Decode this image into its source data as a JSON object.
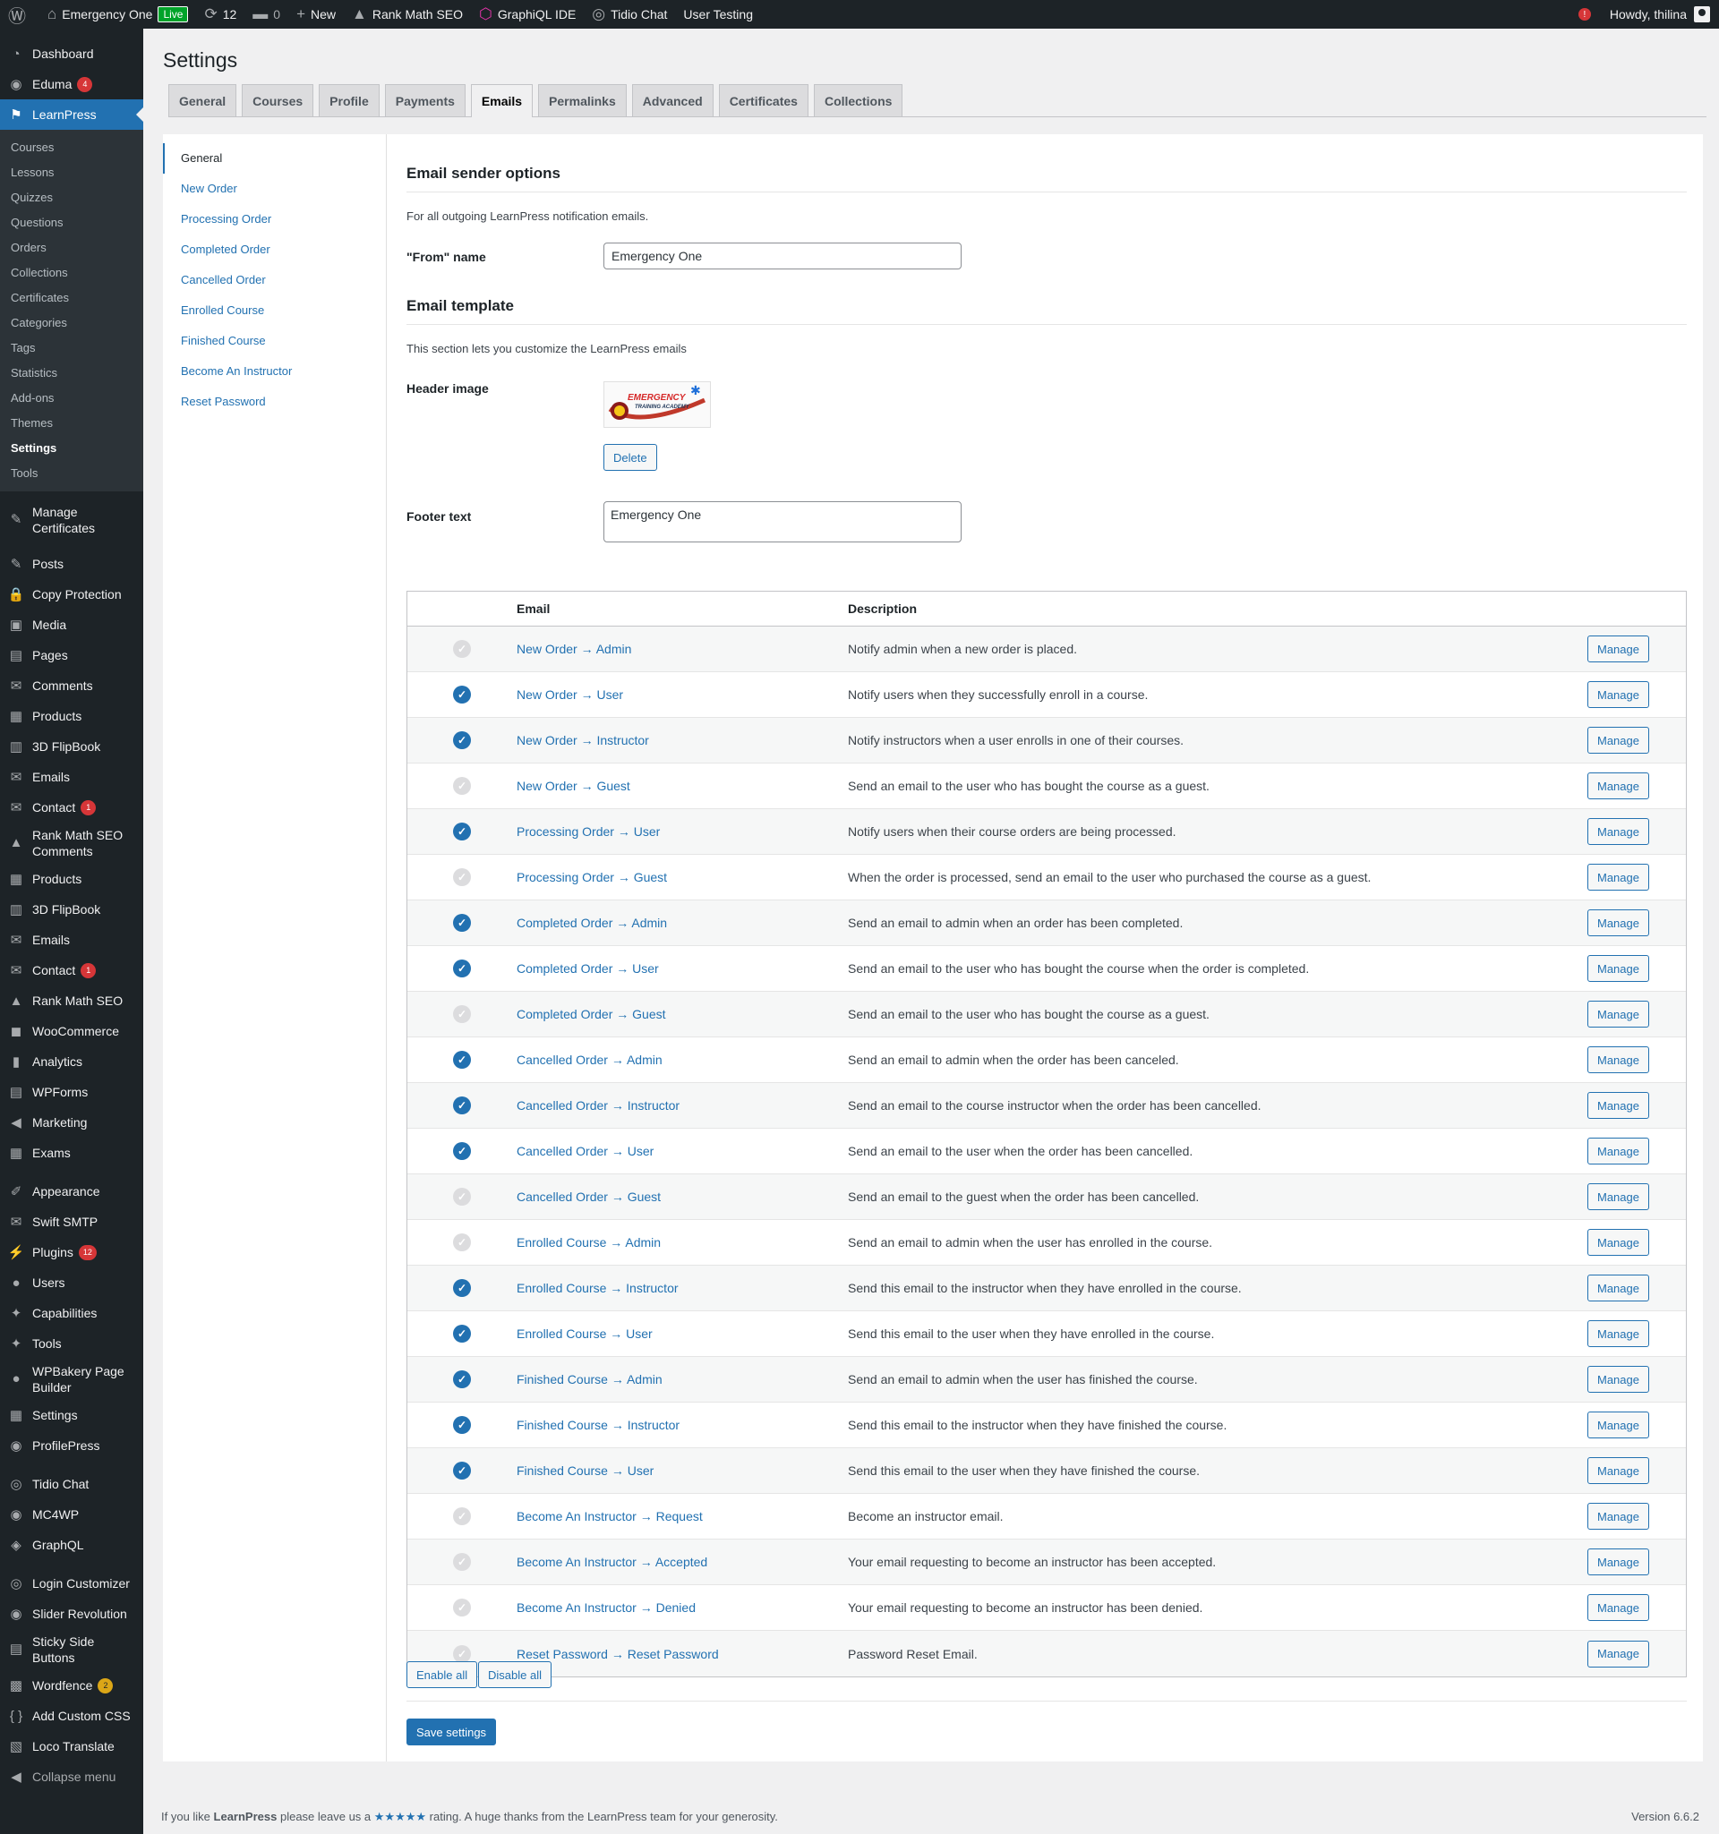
{
  "adminbar": {
    "site_name": "Emergency One",
    "live_badge": "Live",
    "updates_count": "12",
    "comments_count": "0",
    "new_label": "New",
    "rankmath": "Rank Math SEO",
    "graphiql": "GraphiQL IDE",
    "tidio": "Tidio Chat",
    "user_testing": "User Testing",
    "notification": "!",
    "howdy": "Howdy, thilina"
  },
  "sidebar": {
    "items_top": [
      {
        "label": "Dashboard",
        "icon": "dashboard-icon",
        "glyph": "◔"
      },
      {
        "label": "Eduma",
        "icon": "eduma-icon",
        "glyph": "◉",
        "count": "4"
      },
      {
        "label": "LearnPress",
        "icon": "learnpress-icon",
        "glyph": "⚑"
      }
    ],
    "submenu": [
      "Courses",
      "Lessons",
      "Quizzes",
      "Questions",
      "Orders",
      "Collections",
      "Certificates",
      "Categories",
      "Tags",
      "Statistics",
      "Add-ons",
      "Themes",
      "Settings",
      "Tools"
    ],
    "active_sub": "Settings",
    "manage_certificates": "Manage Certificates",
    "items_mid": [
      {
        "label": "Posts",
        "glyph": "✎",
        "icon": "pin-icon"
      },
      {
        "label": "Copy Protection",
        "glyph": "🔒",
        "icon": "lock-icon"
      },
      {
        "label": "Media",
        "glyph": "▣",
        "icon": "media-icon"
      },
      {
        "label": "Pages",
        "glyph": "▤",
        "icon": "pages-icon"
      },
      {
        "label": "Comments",
        "glyph": "✉",
        "icon": "comments-icon"
      },
      {
        "label": "Products",
        "glyph": "▦",
        "icon": "products-icon"
      },
      {
        "label": "3D FlipBook",
        "glyph": "▥",
        "icon": "flipbook-icon"
      },
      {
        "label": "Emails",
        "glyph": "✉",
        "icon": "email-icon"
      },
      {
        "label": "Contact",
        "glyph": "✉",
        "icon": "contact-icon",
        "count": "1"
      },
      {
        "label": "Rank Math SEO Comments",
        "glyph": "▲",
        "icon": "rankmath-icon",
        "two": true
      },
      {
        "label": "Products",
        "glyph": "▦",
        "icon": "products-icon"
      },
      {
        "label": "3D FlipBook",
        "glyph": "▥",
        "icon": "flipbook-icon"
      },
      {
        "label": "Emails",
        "glyph": "✉",
        "icon": "email-icon"
      },
      {
        "label": "Contact",
        "glyph": "✉",
        "icon": "contact-icon",
        "count": "1"
      },
      {
        "label": "Rank Math SEO",
        "glyph": "▲",
        "icon": "rankmath-icon"
      },
      {
        "label": "WooCommerce",
        "glyph": "◼",
        "icon": "woocommerce-icon"
      },
      {
        "label": "Analytics",
        "glyph": "▮",
        "icon": "analytics-icon"
      },
      {
        "label": "WPForms",
        "glyph": "▤",
        "icon": "wpforms-icon"
      },
      {
        "label": "Marketing",
        "glyph": "◀",
        "icon": "marketing-icon"
      },
      {
        "label": "Exams",
        "glyph": "▦",
        "icon": "exams-icon"
      }
    ],
    "items_low": [
      {
        "label": "Appearance",
        "glyph": "✐",
        "icon": "appearance-icon"
      },
      {
        "label": "Swift SMTP",
        "glyph": "✉",
        "icon": "smtp-icon"
      },
      {
        "label": "Plugins",
        "glyph": "⚡",
        "icon": "plugins-icon",
        "count": "12"
      },
      {
        "label": "Users",
        "glyph": "●",
        "icon": "users-icon"
      },
      {
        "label": "Capabilities",
        "glyph": "✦",
        "icon": "capabilities-icon"
      },
      {
        "label": "Tools",
        "glyph": "✦",
        "icon": "tools-icon"
      },
      {
        "label": "WPBakery Page Builder",
        "glyph": "●",
        "icon": "wpbakery-icon",
        "two": true
      },
      {
        "label": "Settings",
        "glyph": "▦",
        "icon": "settings-icon"
      },
      {
        "label": "ProfilePress",
        "glyph": "◉",
        "icon": "profilepress-icon"
      }
    ],
    "items_bottom": [
      {
        "label": "Tidio Chat",
        "glyph": "◎",
        "icon": "tidio-icon"
      },
      {
        "label": "MC4WP",
        "glyph": "◉",
        "icon": "mc4wp-icon"
      },
      {
        "label": "GraphQL",
        "glyph": "◈",
        "icon": "graphql-icon"
      }
    ],
    "items_end": [
      {
        "label": "Login Customizer",
        "glyph": "◎",
        "icon": "login-customizer-icon"
      },
      {
        "label": "Slider Revolution",
        "glyph": "◉",
        "icon": "slider-icon"
      },
      {
        "label": "Sticky Side Buttons",
        "glyph": "▤",
        "icon": "sticky-icon",
        "two": true
      },
      {
        "label": "Wordfence",
        "glyph": "▩",
        "icon": "wordfence-icon",
        "count": "2",
        "yellow": true
      },
      {
        "label": "Add Custom CSS",
        "glyph": "{ }",
        "icon": "css-icon"
      },
      {
        "label": "Loco Translate",
        "glyph": "▧",
        "icon": "loco-icon"
      }
    ],
    "collapse": "Collapse menu"
  },
  "page": {
    "title": "Settings",
    "tabs": [
      "General",
      "Courses",
      "Profile",
      "Payments",
      "Emails",
      "Permalinks",
      "Advanced",
      "Certificates",
      "Collections"
    ],
    "active_tab": "Emails"
  },
  "email_nav": [
    "General",
    "New Order",
    "Processing Order",
    "Completed Order",
    "Cancelled Order",
    "Enrolled Course",
    "Finished Course",
    "Become An Instructor",
    "Reset Password"
  ],
  "sender": {
    "heading": "Email sender options",
    "description": "For all outgoing LearnPress notification emails.",
    "from_label": "\"From\" name",
    "from_value": "Emergency One"
  },
  "template": {
    "heading": "Email template",
    "description": "This section lets you customize the LearnPress emails",
    "header_image_label": "Header image",
    "logo_text_line1": "EMERGENCY",
    "logo_text_line2": "TRAINING ACADEMY",
    "delete_label": "Delete",
    "footer_label": "Footer text",
    "footer_value": "Emergency One"
  },
  "table": {
    "col_email": "Email",
    "col_description": "Description",
    "manage_label": "Manage",
    "rows": [
      {
        "email": "New Order → Admin",
        "desc": "Notify admin when a new order is placed.",
        "enabled": false
      },
      {
        "email": "New Order → User",
        "desc": "Notify users when they successfully enroll in a course.",
        "enabled": true
      },
      {
        "email": "New Order → Instructor",
        "desc": "Notify instructors when a user enrolls in one of their courses.",
        "enabled": true
      },
      {
        "email": "New Order → Guest",
        "desc": "Send an email to the user who has bought the course as a guest.",
        "enabled": false
      },
      {
        "email": "Processing Order → User",
        "desc": "Notify users when their course orders are being processed.",
        "enabled": true
      },
      {
        "email": "Processing Order → Guest",
        "desc": "When the order is processed, send an email to the user who purchased the course as a guest.",
        "enabled": false
      },
      {
        "email": "Completed Order → Admin",
        "desc": "Send an email to admin when an order has been completed.",
        "enabled": true
      },
      {
        "email": "Completed Order → User",
        "desc": "Send an email to the user who has bought the course when the order is completed.",
        "enabled": true
      },
      {
        "email": "Completed Order → Guest",
        "desc": "Send an email to the user who has bought the course as a guest.",
        "enabled": false
      },
      {
        "email": "Cancelled Order → Admin",
        "desc": "Send an email to admin when the order has been canceled.",
        "enabled": true
      },
      {
        "email": "Cancelled Order → Instructor",
        "desc": "Send an email to the course instructor when the order has been cancelled.",
        "enabled": true
      },
      {
        "email": "Cancelled Order → User",
        "desc": "Send an email to the user when the order has been cancelled.",
        "enabled": true
      },
      {
        "email": "Cancelled Order → Guest",
        "desc": "Send an email to the guest when the order has been cancelled.",
        "enabled": false
      },
      {
        "email": "Enrolled Course → Admin",
        "desc": "Send an email to admin when the user has enrolled in the course.",
        "enabled": false
      },
      {
        "email": "Enrolled Course → Instructor",
        "desc": "Send this email to the instructor when they have enrolled in the course.",
        "enabled": true
      },
      {
        "email": "Enrolled Course → User",
        "desc": "Send this email to the user when they have enrolled in the course.",
        "enabled": true
      },
      {
        "email": "Finished Course → Admin",
        "desc": "Send an email to admin when the user has finished the course.",
        "enabled": true
      },
      {
        "email": "Finished Course → Instructor",
        "desc": "Send this email to the instructor when they have finished the course.",
        "enabled": true
      },
      {
        "email": "Finished Course → User",
        "desc": "Send this email to the user when they have finished the course.",
        "enabled": true
      },
      {
        "email": "Become An Instructor → Request",
        "desc": "Become an instructor email.",
        "enabled": false
      },
      {
        "email": "Become An Instructor → Accepted",
        "desc": "Your email requesting to become an instructor has been accepted.",
        "enabled": false
      },
      {
        "email": "Become An Instructor → Denied",
        "desc": "Your email requesting to become an instructor has been denied.",
        "enabled": false
      },
      {
        "email": "Reset Password → Reset Password",
        "desc": "Password Reset Email.",
        "enabled": false
      }
    ]
  },
  "actions": {
    "enable_all": "Enable all",
    "disable_all": "Disable all",
    "save": "Save settings"
  },
  "footer": {
    "prefix": "If you like ",
    "brand": "LearnPress",
    "mid": " please leave us a ",
    "stars": "★★★★★",
    "suffix": " rating. A huge thanks from the LearnPress team for your generosity.",
    "version": "Version 6.6.2"
  }
}
